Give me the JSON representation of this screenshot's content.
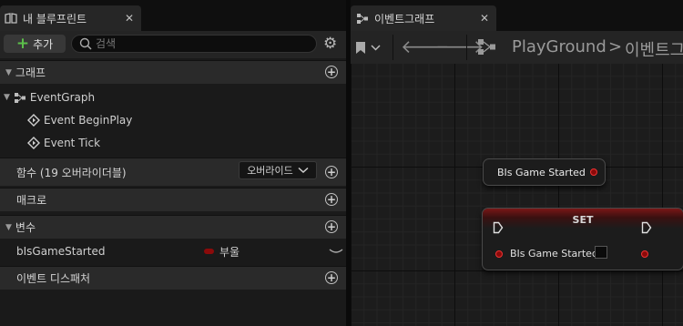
{
  "my_blueprint": {
    "tab_title": "내 블루프린트",
    "add_label": "추가",
    "search_placeholder": "검색",
    "sections": {
      "graphs": "그래프",
      "functions": "함수 (19 오버라이더블)",
      "override_label": "오버라이드",
      "macros": "매크로",
      "variables": "변수",
      "event_dispatchers": "이벤트 디스패처"
    },
    "graph_items": {
      "event_graph": "EventGraph",
      "begin_play": "Event BeginPlay",
      "tick": "Event Tick"
    },
    "variable": {
      "name": "bIsGameStarted",
      "type": "부울",
      "type_color": "#8b0a0a"
    }
  },
  "graph_editor": {
    "tab_title": "이벤트그래프",
    "breadcrumb_root": "PlayGround",
    "breadcrumb_separator": ">",
    "breadcrumb_current": "이벤트그래",
    "get_node_label": "BIs Game Started",
    "set_node": {
      "title": "SET",
      "pin_label": "BIs Game Started"
    }
  },
  "colors": {
    "accent_add": "#5cbf4a",
    "bool_pin": "#e33333",
    "set_header": "#7a1717"
  }
}
